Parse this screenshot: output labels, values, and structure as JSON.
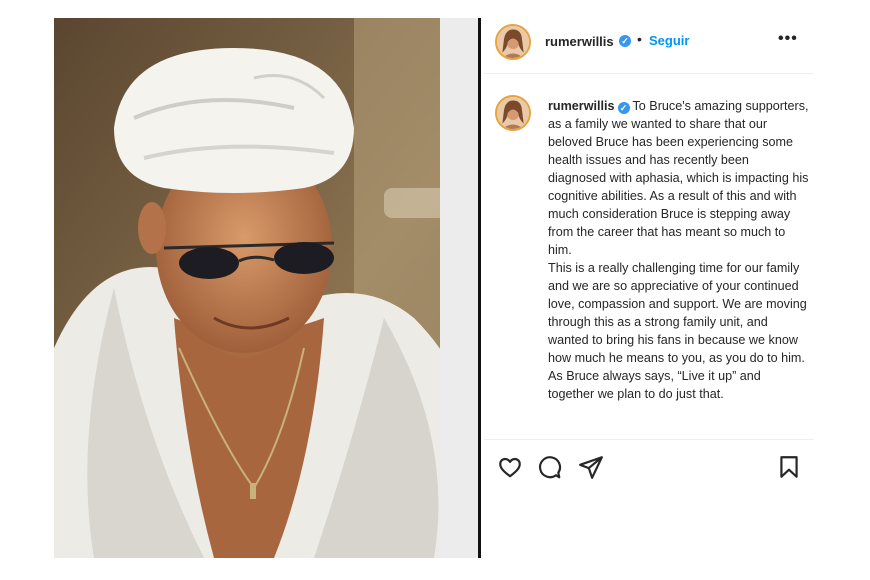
{
  "post": {
    "username": "rumerwillis",
    "separator": "•",
    "follow_label": "Seguir",
    "more_label": "•••",
    "verified_mark": "✓",
    "accent_color": "#0095f6",
    "verified_color": "#3797f0"
  },
  "caption": {
    "username": "rumerwillis",
    "paragraphs": [
      "To Bruce's amazing supporters, as a family we wanted to share that our beloved Bruce has been experiencing some health issues and has recently been diagnosed with aphasia, which is impacting his cognitive abilities. As a result of this and with much consideration Bruce is stepping away from the career that has meant so much to him.",
      "This is a really challenging time for our family and we are so appreciative of your continued love, compassion and support. We are moving through this as a strong family unit, and wanted to bring his fans in because we know how much he means to you, as you do to him.",
      "As Bruce always says, “Live it up” and together we plan to do just that."
    ]
  },
  "actions": {
    "icons": [
      "heart-icon",
      "comment-icon",
      "share-icon",
      "bookmark-icon"
    ]
  }
}
